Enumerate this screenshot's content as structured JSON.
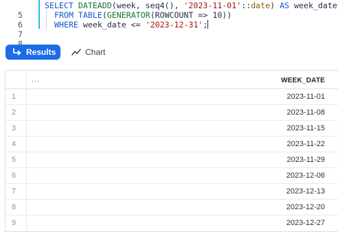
{
  "editor": {
    "lines": [
      {
        "number": "5"
      },
      {
        "number": "6"
      },
      {
        "number": "7"
      },
      {
        "number": "8"
      }
    ],
    "tokens": {
      "l5_select": "SELECT",
      "l5_fn": "DATEADD",
      "l5_args": "(week, seq4(), ",
      "l5_str": "'2023-11-01'",
      "l5_cast": "::",
      "l5_type": "date",
      "l5_close": ") ",
      "l5_as": "AS",
      "l5_alias": " week_date",
      "l6_from": "FROM",
      "l6_sp": " ",
      "l6_table": "TABLE",
      "l6_p1": "(",
      "l6_gen": "GENERATOR",
      "l6_args": "(ROWCOUNT => 10))",
      "l7_where": "WHERE",
      "l7_cond": " week_date <= ",
      "l7_str": "'2023-12-31'",
      "l7_end": ";"
    }
  },
  "toolbar": {
    "results_label": "Results",
    "chart_label": "Chart"
  },
  "grid": {
    "header_ellipsis": "...",
    "column_header": "WEEK_DATE",
    "rows": [
      {
        "num": "1",
        "week_date": "2023-11-01"
      },
      {
        "num": "2",
        "week_date": "2023-11-08"
      },
      {
        "num": "3",
        "week_date": "2023-11-15"
      },
      {
        "num": "4",
        "week_date": "2023-11-22"
      },
      {
        "num": "5",
        "week_date": "2023-11-29"
      },
      {
        "num": "6",
        "week_date": "2023-12-06"
      },
      {
        "num": "7",
        "week_date": "2023-12-13"
      },
      {
        "num": "8",
        "week_date": "2023-12-20"
      },
      {
        "num": "9",
        "week_date": "2023-12-27"
      }
    ]
  },
  "colors": {
    "accent": "#1a6ce7",
    "editor_active_bar": "#29b5e8",
    "keyword": "#1155cc",
    "function": "#137333",
    "string": "#a31515"
  },
  "icons": {
    "results_tab": "return-arrow-icon",
    "chart_tab": "line-chart-icon"
  }
}
